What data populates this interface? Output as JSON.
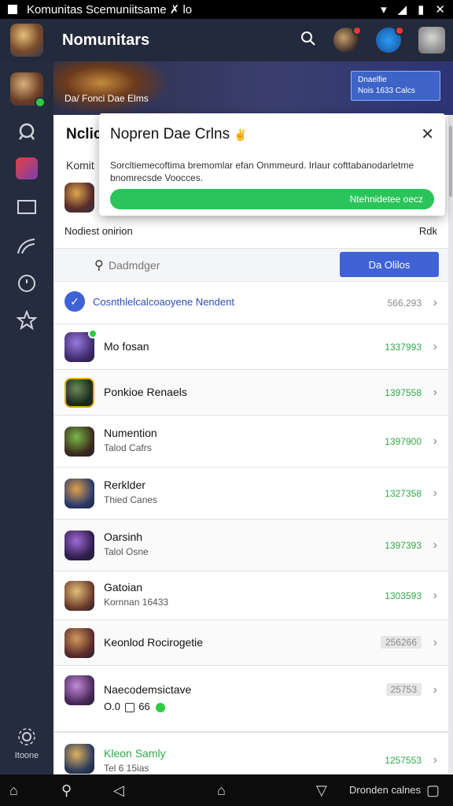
{
  "status_bar": {
    "title": "Komunitas Scemuniitsame ✗ lo"
  },
  "top_bar": {
    "title": "Nomunitars"
  },
  "banner": {
    "text": "Da/ Fonci Dae Elms",
    "box_line1": "Dnaelfie",
    "box_line2": "Nois 1633 Calcs"
  },
  "under_card": {
    "title": "Nclic",
    "subtitle": "Komit"
  },
  "modal": {
    "title": "Nopren Dae Crlns",
    "body": "Sorcltiemecoftima bremomlar efan Onmmeurd. Irlaur cofttabanodarletme bnomrecsde Voocces.",
    "button_label": "Ntehnidetee oecz"
  },
  "notif_row": {
    "label": "Nodiest onirion",
    "value": "Rdk"
  },
  "search": {
    "placeholder": "Dadmdger",
    "button": "Da Olilos"
  },
  "list": {
    "first": {
      "name": "Cosnthlelcalcoaoyene Nendent",
      "count": "566.293"
    },
    "items": [
      {
        "name": "Mo fosan",
        "sub": "",
        "count": "1337993"
      },
      {
        "name": "Ponkioe Renaels",
        "sub": "",
        "count": "1397558"
      },
      {
        "name": "Numention",
        "sub": "Talod Cafrs",
        "count": "1397900"
      },
      {
        "name": "Rerklder",
        "sub": "Thied Canes",
        "count": "1327358"
      },
      {
        "name": "Oarsinh",
        "sub": "Talol Osne",
        "count": "1397393"
      },
      {
        "name": "Gatoian",
        "sub": "Kornnan 16433",
        "count": "1303593"
      },
      {
        "name": "Keonlod Rocirogetie",
        "sub": "",
        "count": "256266"
      },
      {
        "name": "Naecodemsictave",
        "sub": "O.0",
        "sub2": "66",
        "count": "25753"
      },
      {
        "name": "Kleon Samly",
        "sub": "Tel 6 15ias",
        "count": "1257553"
      }
    ]
  },
  "sidebar": {
    "bottom_label": "Itoone"
  },
  "nav_bar": {
    "label": "Dronden calnes"
  }
}
